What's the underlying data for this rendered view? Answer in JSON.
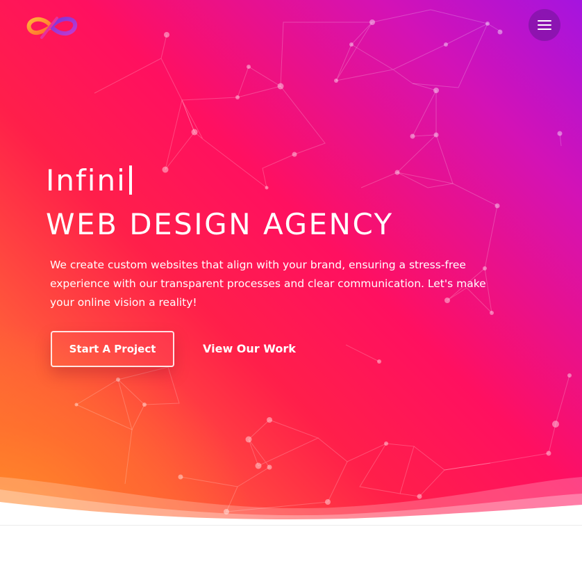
{
  "header": {
    "logo_icon": "infinity-logo",
    "menu_icon": "hamburger-menu-icon"
  },
  "hero": {
    "brand": "Infini",
    "tagline": "WEB DESIGN AGENCY",
    "description": "We create custom websites that align with your brand, ensuring a stress-free experience with our transparent processes and clear communication. Let's make your online vision a reality!",
    "primary_cta": "Start A Project",
    "secondary_cta": "View Our Work"
  },
  "colors": {
    "gradient_top_right": "#a514df",
    "gradient_magenta": "#d312b6",
    "gradient_pink_red": "#ff1060",
    "gradient_orange": "#ff7a30",
    "text": "#ffffff",
    "page_background": "#ffffff"
  }
}
